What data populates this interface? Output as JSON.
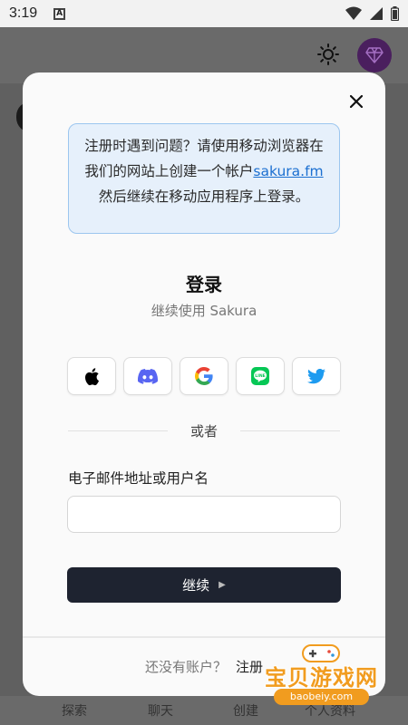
{
  "status_bar": {
    "time": "3:19",
    "notification_badge": "A"
  },
  "background_app": {
    "bottom_nav": [
      {
        "label": "探索"
      },
      {
        "label": "聊天"
      },
      {
        "label": "创建"
      },
      {
        "label": "个人资料"
      }
    ],
    "accent_color": "#4a1f5e"
  },
  "notice": {
    "line_before_link": "注册时遇到问题？请使用移动浏览器在我们的网站上创建一个帐户",
    "link_text": "sakura.fm",
    "line_after_link": " 然后继续在移动应用程序上登录。"
  },
  "login": {
    "title": "登录",
    "subtitle": "继续使用 Sakura",
    "social_buttons": [
      {
        "icon": "apple-icon"
      },
      {
        "icon": "discord-icon"
      },
      {
        "icon": "google-icon"
      },
      {
        "icon": "line-icon"
      },
      {
        "icon": "twitter-icon"
      }
    ],
    "divider_text": "或者",
    "field_label": "电子邮件地址或用户名",
    "field_value": "",
    "field_placeholder": "",
    "continue_label": "继续",
    "signup_prompt": "还没有账户？",
    "signup_link": "注册"
  },
  "watermark": {
    "text": "宝贝游戏网",
    "url": "baobeiy.com"
  }
}
